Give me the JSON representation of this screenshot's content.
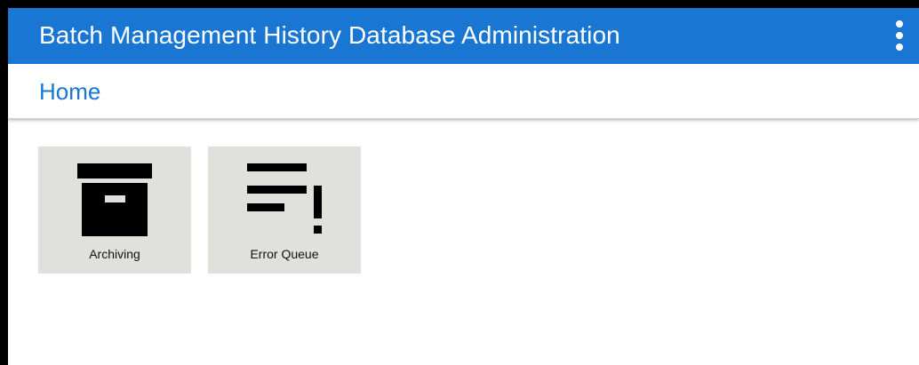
{
  "app": {
    "title": "Batch Management History Database Administration",
    "menu_icon": "more-vert-icon"
  },
  "breadcrumb": {
    "label": "Home"
  },
  "tiles": [
    {
      "label": "Archiving",
      "icon": "archive-box-icon"
    },
    {
      "label": "Error Queue",
      "icon": "error-queue-icon"
    }
  ],
  "colors": {
    "primary": "#1976d2",
    "tile_background": "#e0e0dc",
    "icon": "#000000"
  }
}
